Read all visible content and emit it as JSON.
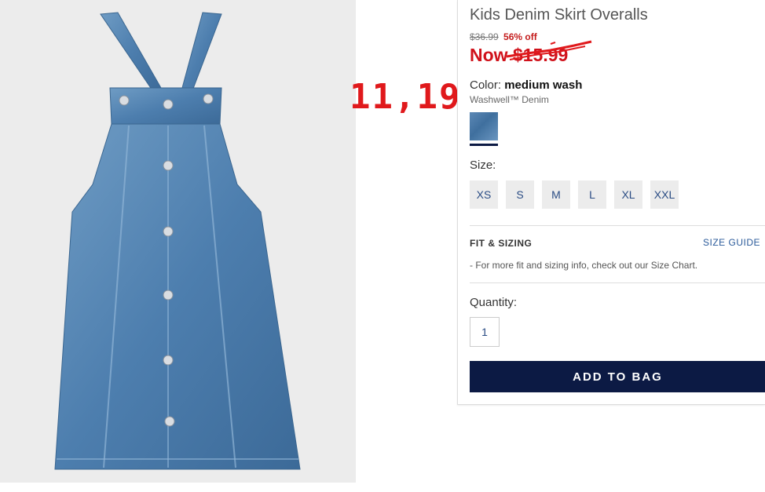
{
  "product": {
    "title": "Kids Denim Skirt Overalls",
    "original_price": "$36.99",
    "discount": "56% off",
    "now_price_prefix": "Now ",
    "now_price_value": "$15.99",
    "image_alt": "denim-skirt-overalls-photo"
  },
  "annotation": {
    "text": "11,19",
    "color": "#e0191c"
  },
  "color": {
    "label": "Color: ",
    "value": "medium wash",
    "fabric": "Washwell™ Denim",
    "swatch_color": "#4f7fae"
  },
  "size": {
    "label": "Size:",
    "options": [
      "XS",
      "S",
      "M",
      "L",
      "XL",
      "XXL"
    ]
  },
  "fit": {
    "title": "FIT & SIZING",
    "guide_link": "SIZE GUIDE",
    "info": "- For more fit and sizing info, check out our Size Chart."
  },
  "quantity": {
    "label": "Quantity:",
    "value": "1"
  },
  "cta": {
    "add_to_bag": "ADD TO BAG"
  },
  "colors": {
    "brand_navy": "#0c1a44",
    "sale_red": "#d0121b",
    "link_blue": "#2a5a9a"
  }
}
